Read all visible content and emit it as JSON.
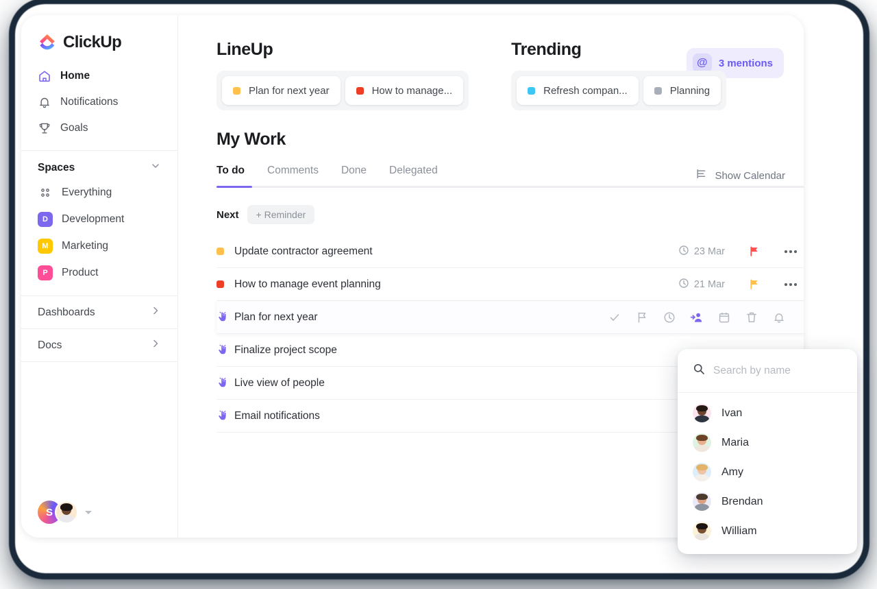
{
  "brand": {
    "name": "ClickUp",
    "accent": "#7b68ee"
  },
  "sidebar": {
    "nav": [
      {
        "label": "Home",
        "icon": "home-icon",
        "active": true
      },
      {
        "label": "Notifications",
        "icon": "bell-icon",
        "active": false
      },
      {
        "label": "Goals",
        "icon": "trophy-icon",
        "active": false
      }
    ],
    "spaces_header": {
      "label": "Spaces",
      "icon": "chevron-down-icon"
    },
    "spaces": [
      {
        "label": "Everything",
        "badge": "",
        "color": "",
        "icon": "grid-dots-icon"
      },
      {
        "label": "Development",
        "badge": "D",
        "color": "#7b68ee"
      },
      {
        "label": "Marketing",
        "badge": "M",
        "color": "#ffc800"
      },
      {
        "label": "Product",
        "badge": "P",
        "color": "#ff4d97"
      }
    ],
    "sections": [
      {
        "label": "Dashboards",
        "icon": "chevron-right-icon"
      },
      {
        "label": "Docs",
        "icon": "chevron-right-icon"
      }
    ],
    "user": {
      "workspace_initial": "S",
      "avatar": "user-avatar",
      "caret": "caret-down-icon"
    }
  },
  "lineup": {
    "title": "LineUp",
    "chips": [
      {
        "label": "Plan for next year",
        "color": "#ffc04d"
      },
      {
        "label": "How to manage...",
        "color": "#ef3e26"
      }
    ]
  },
  "trending": {
    "title": "Trending",
    "chips": [
      {
        "label": "Refresh compan...",
        "color": "#3ec6f5"
      },
      {
        "label": "Planning",
        "color": "#a9afb8"
      }
    ]
  },
  "mentions": {
    "label": "3 mentions",
    "icon": "at-icon"
  },
  "my_work": {
    "title": "My Work",
    "tabs": [
      {
        "label": "To do",
        "active": true
      },
      {
        "label": "Comments",
        "active": false
      },
      {
        "label": "Done",
        "active": false
      },
      {
        "label": "Delegated",
        "active": false
      }
    ],
    "show_calendar": {
      "label": "Show Calendar",
      "icon": "calendar-toggle-icon"
    },
    "group": {
      "label": "Next",
      "add_label": "+ Reminder"
    },
    "tasks": [
      {
        "title": "Update contractor agreement",
        "marker": "square",
        "color": "#ffc04d",
        "due": "23 Mar",
        "flag_color": "#ff5252",
        "menu": "more-icon",
        "selected": false
      },
      {
        "title": "How to manage event planning",
        "marker": "square",
        "color": "#ef3e26",
        "due": "21 Mar",
        "flag_color": "#ffc04d",
        "menu": "more-icon",
        "selected": false
      },
      {
        "title": "Plan for next year",
        "marker": "hand",
        "color": "#7b68ee",
        "due": "",
        "flag_color": "",
        "selected": true
      },
      {
        "title": "Finalize project scope",
        "marker": "hand",
        "color": "#7b68ee",
        "due": "",
        "flag_color": "",
        "selected": false
      },
      {
        "title": "Live view of people",
        "marker": "hand",
        "color": "#7b68ee",
        "due": "",
        "flag_color": "",
        "selected": false
      },
      {
        "title": "Email notifications",
        "marker": "hand",
        "color": "#7b68ee",
        "due": "",
        "flag_color": "",
        "selected": false
      }
    ],
    "row_actions": [
      {
        "name": "resolve-check-icon",
        "active": false
      },
      {
        "name": "flag-icon",
        "active": false
      },
      {
        "name": "clock-icon",
        "active": false
      },
      {
        "name": "assign-user-icon",
        "active": true
      },
      {
        "name": "calendar-icon",
        "active": false
      },
      {
        "name": "trash-icon",
        "active": false
      },
      {
        "name": "reminder-bell-icon",
        "active": false
      }
    ]
  },
  "people_popup": {
    "search": {
      "placeholder": "Search by name",
      "value": "",
      "icon": "search-icon"
    },
    "people": [
      {
        "name": "Ivan",
        "ring": "#fbe4ee",
        "skin": "#6b4530",
        "hair": "#241a14",
        "shirt": "#2e3440"
      },
      {
        "name": "Maria",
        "ring": "#dff3e2",
        "skin": "#e8b08c",
        "hair": "#6b4428",
        "shirt": "#efe6de"
      },
      {
        "name": "Amy",
        "ring": "#ddeefb",
        "skin": "#f0c3a4",
        "hair": "#e3b36a",
        "shirt": "#f4efe9"
      },
      {
        "name": "Brendan",
        "ring": "#ece9f6",
        "skin": "#d8a183",
        "hair": "#4a3a2e",
        "shirt": "#8d94a2"
      },
      {
        "name": "William",
        "ring": "#fdf1d8",
        "skin": "#7a4f31",
        "hair": "#1d1512",
        "shirt": "#e9e4dd"
      }
    ]
  }
}
